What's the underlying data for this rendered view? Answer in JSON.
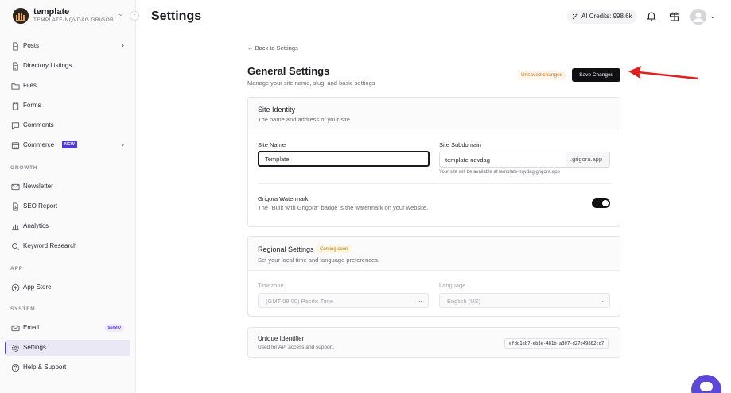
{
  "sidebar": {
    "workspace": {
      "title": "template",
      "subtitle": "TEMPLATE-NQVDAG.GRIGOR..."
    },
    "collapse_glyph": "‹",
    "items": [
      {
        "label": "Posts",
        "icon": "document-icon",
        "chevron": "›"
      },
      {
        "label": "Directory Listings",
        "icon": "document-list-icon"
      },
      {
        "label": "Files",
        "icon": "folder-icon"
      },
      {
        "label": "Forms",
        "icon": "clipboard-icon"
      },
      {
        "label": "Comments",
        "icon": "chat-bubble-icon"
      },
      {
        "label": "Commerce",
        "icon": "storefront-icon",
        "badge": "NEW",
        "chevron": "›"
      }
    ],
    "sections": {
      "growth": {
        "title": "GROWTH",
        "items": [
          {
            "label": "Newsletter",
            "icon": "mail-icon"
          },
          {
            "label": "SEO Report",
            "icon": "report-icon"
          },
          {
            "label": "Analytics",
            "icon": "bar-chart-icon"
          },
          {
            "label": "Keyword Research",
            "icon": "search-icon"
          }
        ]
      },
      "app": {
        "title": "APP",
        "items": [
          {
            "label": "App Store",
            "icon": "app-store-icon"
          }
        ]
      },
      "system": {
        "title": "SYSTEM",
        "items": [
          {
            "label": "Email",
            "icon": "mail-icon",
            "badge": "$5/MO"
          },
          {
            "label": "Settings",
            "icon": "gear-icon",
            "active": true
          },
          {
            "label": "Help & Support",
            "icon": "help-circle-icon"
          }
        ]
      }
    }
  },
  "header": {
    "title": "Settings",
    "credits": "AI Credits: 998.6k",
    "icons": [
      "sparkle-icon",
      "bell-icon",
      "gift-icon",
      "avatar"
    ]
  },
  "main": {
    "back_link": "← Back to Settings",
    "title": "General Settings",
    "subtitle": "Manage your site name, slug, and basic settings",
    "unsaved_label": "Unsaved changes",
    "save_label": "Save Changes",
    "site_identity": {
      "title": "Site Identity",
      "description": "The name and address of your site.",
      "site_name_label": "Site Name",
      "site_name_value": "Template",
      "subdomain_label": "Site Subdomain",
      "subdomain_value": "template-nqvdag",
      "subdomain_suffix": ".grigora.app",
      "subdomain_hint": "Your site will be available at template-nqvdag.grigora.app",
      "watermark_label": "Grigora Watermark",
      "watermark_desc": "The \"Built with Grigora\" badge is the watermark on your website.",
      "watermark_enabled": true
    },
    "regional": {
      "title": "Regional Settings",
      "badge": "Coming soon",
      "description": "Set your local time and language preferences.",
      "timezone_label": "Timezone",
      "timezone_value": "(GMT-08:00) Pacific Time",
      "language_label": "Language",
      "language_value": "English (US)"
    },
    "identifier": {
      "title": "Unique Identifier",
      "description": "Used for API access and support.",
      "value": "efdd1eb7-eb3e-481b-a307-d27b49802cd7"
    }
  },
  "colors": {
    "accent": "#5a44c8",
    "primary_button": "#111114",
    "annotation_arrow": "#e02020",
    "unsaved_text": "#c2751e"
  }
}
